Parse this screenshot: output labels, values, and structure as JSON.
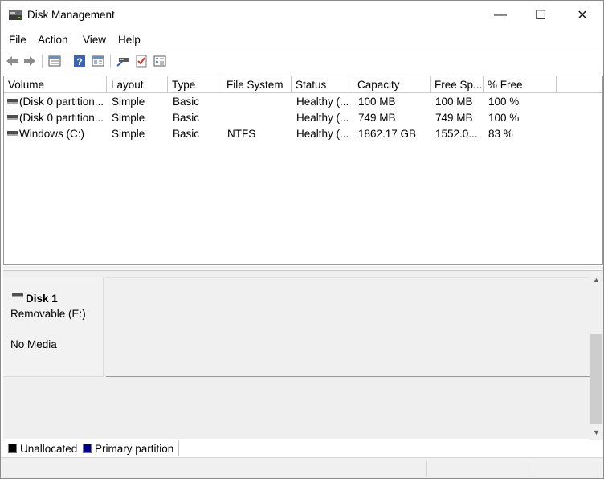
{
  "window": {
    "title": "Disk Management",
    "minimize_glyph": "—",
    "maximize_glyph": "☐",
    "close_glyph": "✕"
  },
  "menu": [
    "File",
    "Action",
    "View",
    "Help"
  ],
  "toolbar_icons": [
    "back-icon",
    "forward-icon",
    "volume-list-icon",
    "help-icon",
    "properties-icon",
    "connect-icon",
    "check-icon",
    "settings-list-icon"
  ],
  "volumes": {
    "columns": [
      "Volume",
      "Layout",
      "Type",
      "File System",
      "Status",
      "Capacity",
      "Free Sp...",
      "% Free"
    ],
    "rows": [
      [
        "(Disk 0 partition...",
        "Simple",
        "Basic",
        "",
        "Healthy (...",
        "100 MB",
        "100 MB",
        "100 %"
      ],
      [
        "(Disk 0 partition...",
        "Simple",
        "Basic",
        "",
        "Healthy (...",
        "749 MB",
        "749 MB",
        "100 %"
      ],
      [
        "Windows (C:)",
        "Simple",
        "Basic",
        "NTFS",
        "Healthy (...",
        "1862.17 GB",
        "1552.0...",
        "83 %"
      ]
    ]
  },
  "disk": {
    "name": "Disk 1",
    "type": "Removable (E:)",
    "media": "No Media"
  },
  "scroll": {
    "up_glyph": "▲",
    "down_glyph": "▼"
  },
  "legend": [
    {
      "label": "Unallocated",
      "color": "#000000"
    },
    {
      "label": "Primary partition",
      "color": "#000080"
    }
  ]
}
